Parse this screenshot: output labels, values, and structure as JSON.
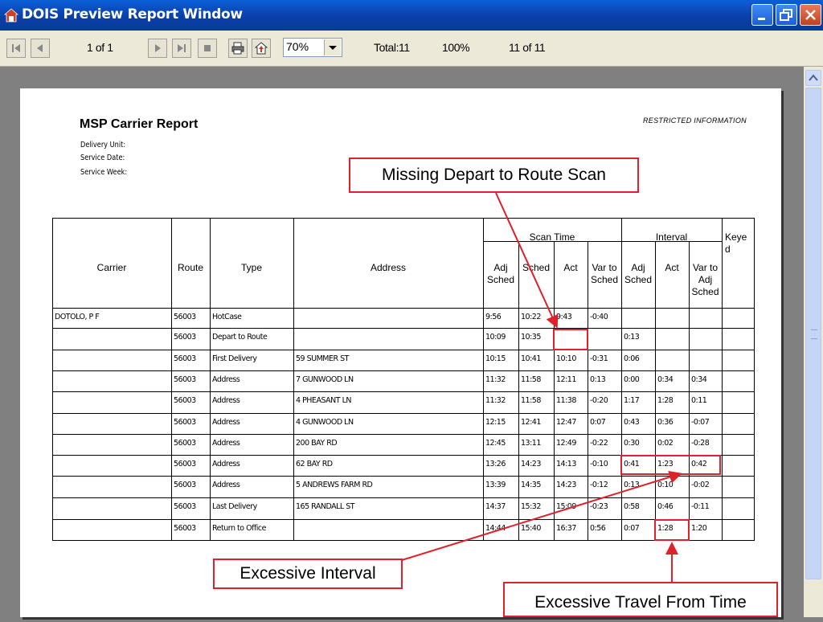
{
  "window": {
    "title": "DOIS Preview Report Window"
  },
  "toolbar": {
    "page_indicator": "1 of 1",
    "zoom": "70%",
    "total": "Total:11",
    "percent": "100%",
    "count": "11 of 11"
  },
  "report": {
    "title": "MSP Carrier Report",
    "labels": [
      "Delivery Unit:",
      "Service Date:",
      "Service Week:"
    ],
    "restricted": "RESTRICTED INFORMATION",
    "headers": {
      "carrier": "Carrier",
      "route": "Route",
      "type": "Type",
      "address": "Address",
      "scan_time": "Scan Time",
      "interval": "Interval",
      "keyed": "Keye\nd",
      "adj_sched": "Adj\nSched",
      "sched": "Sched",
      "act": "Act",
      "var_to_sched": "Var to\nSched",
      "i_adj_sched": "Adj\nSched",
      "i_act": "Act",
      "var_to_adj_sched": "Var to\nAdj\nSched"
    },
    "rows": [
      [
        "DOTOLO, P F",
        "56003",
        "HotCase",
        "",
        "9:56",
        "10:22",
        "9:43",
        "-0:40",
        "",
        "",
        ""
      ],
      [
        "",
        "56003",
        "Depart to Route",
        "",
        "10:09",
        "10:35",
        "",
        "",
        "0:13",
        "",
        ""
      ],
      [
        "",
        "56003",
        "First Delivery",
        "59 SUMMER ST",
        "10:15",
        "10:41",
        "10:10",
        "-0:31",
        "0:06",
        "",
        ""
      ],
      [
        "",
        "56003",
        "Address",
        "7 GUNWOOD LN",
        "11:32",
        "11:58",
        "12:11",
        "0:13",
        "0:00",
        "0:34",
        "0:34"
      ],
      [
        "",
        "56003",
        "Address",
        "4 PHEASANT LN",
        "11:32",
        "11:58",
        "11:38",
        "-0:20",
        "1:17",
        "1:28",
        "0:11"
      ],
      [
        "",
        "56003",
        "Address",
        "4 GUNWOOD LN",
        "12:15",
        "12:41",
        "12:47",
        "0:07",
        "0:43",
        "0:36",
        "-0:07"
      ],
      [
        "",
        "56003",
        "Address",
        "200 BAY RD",
        "12:45",
        "13:11",
        "12:49",
        "-0:22",
        "0:30",
        "0:02",
        "-0:28"
      ],
      [
        "",
        "56003",
        "Address",
        "62 BAY RD",
        "13:26",
        "14:23",
        "14:13",
        "-0:10",
        "0:41",
        "1:23",
        "0:42"
      ],
      [
        "",
        "56003",
        "Address",
        "5 ANDREWS FARM RD",
        "13:39",
        "14:35",
        "14:23",
        "-0:12",
        "0:13",
        "0:10",
        "-0:02"
      ],
      [
        "",
        "56003",
        "Last Delivery",
        "165 RANDALL ST",
        "14:37",
        "15:32",
        "15:09",
        "-0:23",
        "0:58",
        "0:46",
        "-0:11"
      ],
      [
        "",
        "56003",
        "Return to Office",
        "",
        "14:44",
        "15:40",
        "16:37",
        "0:56",
        "0:07",
        "1:28",
        "1:20"
      ]
    ]
  },
  "annotations": {
    "missing_depart": "Missing Depart to Route Scan",
    "excessive_interval": "Excessive Interval",
    "excessive_travel": "Excessive Travel From Time"
  },
  "colors": {
    "annotation": "#e0202a",
    "titlebar": "#0a4fc8"
  }
}
